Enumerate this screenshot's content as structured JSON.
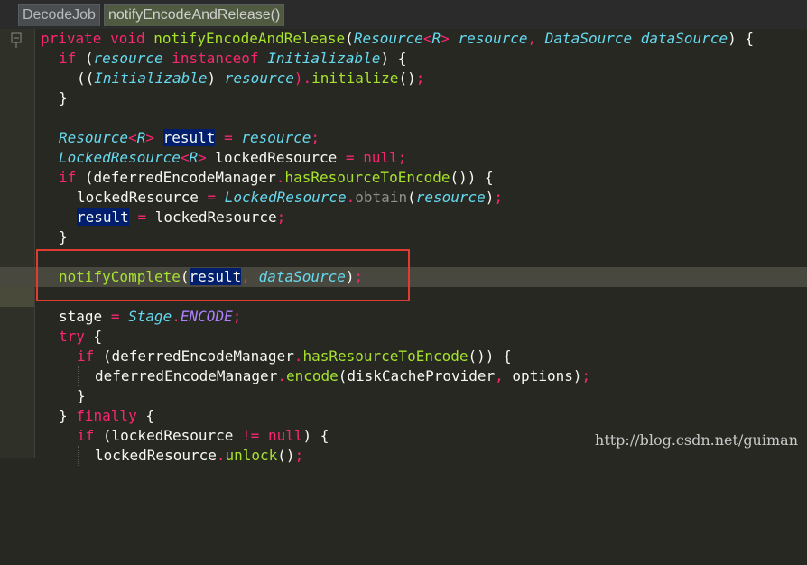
{
  "breadcrumb": {
    "class_name": "DecodeJob",
    "method_name": "notifyEncodeAndRelease()"
  },
  "code": {
    "line1": {
      "kw1": "private",
      "kw2": "void",
      "name": "notifyEncodeAndRelease",
      "p1": "(",
      "t1": "Resource",
      "lt": "<",
      "tR": "R",
      "gt": ">",
      "a1": "resource",
      "comma": ",",
      "t2": "DataSource",
      "a2": "dataSource",
      "end": ") {"
    },
    "line2": {
      "kw": "if",
      "open": " (",
      "a": "resource",
      "kw2": "instanceof",
      "t": "Initializable",
      "end": ") {"
    },
    "line3": {
      "open": "((",
      "t": "Initializable",
      "close": ")",
      "a": "resource",
      "rest": ").",
      "m": "initialize",
      "args": "()",
      "semi": ";"
    },
    "line4": {
      "text": "}"
    },
    "line6": {
      "t": "Resource",
      "lt": "<",
      "tR": "R",
      "gt": ">",
      "v": "result",
      "eq": "=",
      "a": "resource",
      "semi": ";"
    },
    "line7": {
      "t": "LockedResource",
      "lt": "<",
      "tR": "R",
      "gt": ">",
      "v": "lockedResource",
      "eq": "=",
      "kw": "null",
      "semi": ";"
    },
    "line8": {
      "kw": "if",
      "p1": " (",
      "obj": "deferredEncodeManager",
      "dot": ".",
      "m": "hasResourceToEncode",
      "end": "()) {"
    },
    "line9": {
      "v": "lockedResource",
      "eq": "=",
      "t": "LockedResource",
      "dot": ".",
      "m": "obtain",
      "p1": "(",
      "a": "resource",
      "p2": ")",
      "semi": ";"
    },
    "line10": {
      "v": "result",
      "eq": "=",
      "a": "lockedResource",
      "semi": ";"
    },
    "line11": {
      "text": "}"
    },
    "line13": {
      "m": "notifyComplete",
      "p1": "(",
      "a1": "result",
      "comma": ",",
      "a2": "dataSource",
      "p2": ")",
      "semi": ";"
    },
    "line15": {
      "v": "stage",
      "eq": "=",
      "t": "Stage",
      "dot": ".",
      "c": "ENCODE",
      "semi": ";"
    },
    "line16": {
      "kw": "try",
      "end": " {"
    },
    "line17": {
      "kw": "if",
      "p1": " (",
      "obj": "deferredEncodeManager",
      "dot": ".",
      "m": "hasResourceToEncode",
      "end": "()) {"
    },
    "line18": {
      "obj": "deferredEncodeManager",
      "dot": ".",
      "m": "encode",
      "p1": "(",
      "a1": "diskCacheProvider",
      "comma": ",",
      "a2": "options",
      "p2": ")",
      "semi": ";"
    },
    "line19": {
      "text": "}"
    },
    "line20": {
      "open": "} ",
      "kw": "finally",
      "end": " {"
    },
    "line21": {
      "kw": "if",
      "p1": " (",
      "a": "lockedResource",
      "op": "!=",
      "kw2": "null",
      "end": ") {"
    },
    "line22": {
      "obj": "lockedResource",
      "dot": ".",
      "m": "unlock",
      "args": "()",
      "semi": ";"
    }
  },
  "watermark": "http://blog.csdn.net/guiman"
}
